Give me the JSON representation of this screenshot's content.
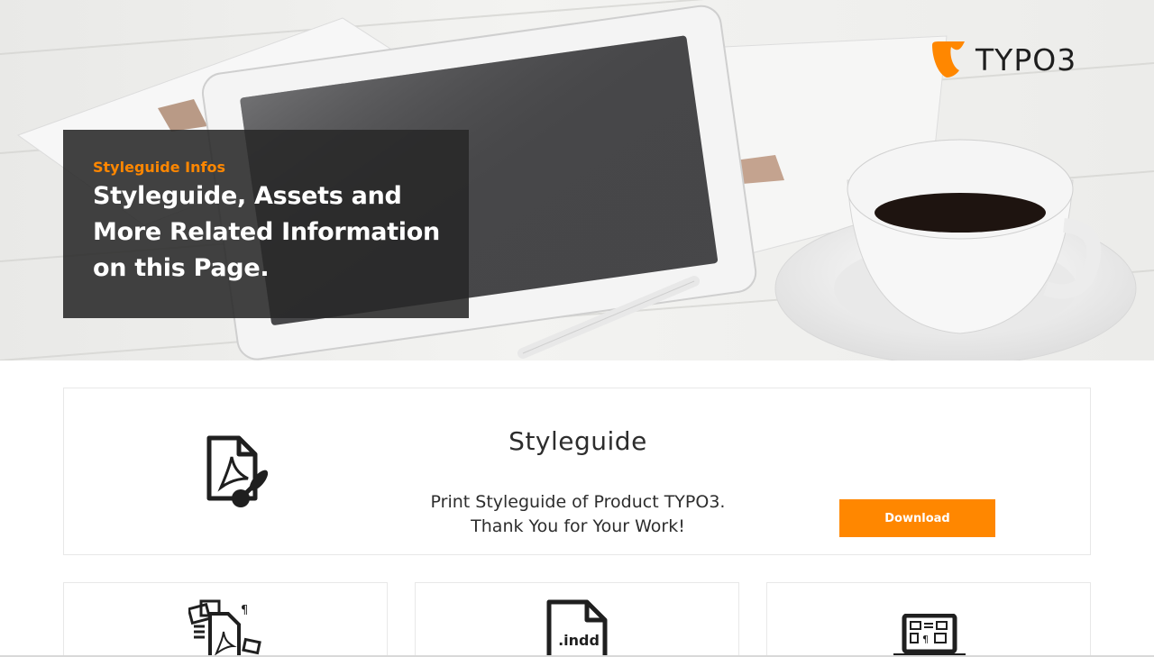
{
  "brand": {
    "logo_text": "TYPO3",
    "accent_color": "#ff8700",
    "logo_icon": "typo3-logo-icon"
  },
  "hero": {
    "kicker": "Styleguide Infos",
    "title": "Styleguide, Assets and More Related Information on this Page.",
    "background": "desk-with-tablet-and-coffee-photo"
  },
  "styleguide_card": {
    "icon": "pdf-document-brush-icon",
    "title": "Styleguide",
    "description_line1": "Print Styleguide of Product TYPO3.",
    "description_line2": "Thank You for Your Work!",
    "button_label": "Download",
    "button_color": "#ff8700"
  },
  "asset_cards": [
    {
      "icon": "assets-collage-pdf-icon"
    },
    {
      "icon": "indd-file-icon",
      "file_label": ".indd"
    },
    {
      "icon": "laptop-layout-icon"
    }
  ]
}
